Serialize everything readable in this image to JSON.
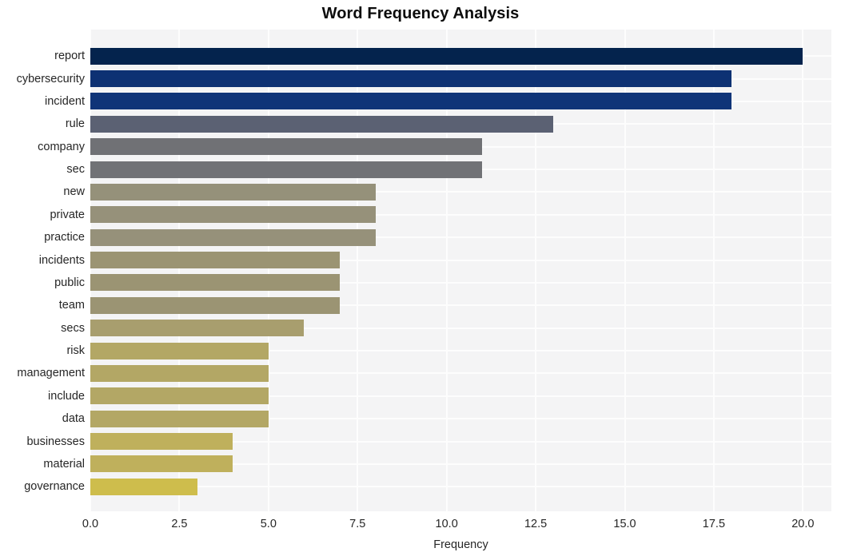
{
  "chart_data": {
    "type": "bar",
    "orientation": "horizontal",
    "title": "Word Frequency Analysis",
    "xlabel": "Frequency",
    "ylabel": "",
    "xlim": [
      0,
      20.8
    ],
    "xticks": [
      "0.0",
      "2.5",
      "5.0",
      "7.5",
      "10.0",
      "12.5",
      "15.0",
      "17.5",
      "20.0"
    ],
    "xtick_values": [
      0,
      2.5,
      5,
      7.5,
      10,
      12.5,
      15,
      17.5,
      20
    ],
    "grid": true,
    "legend": false,
    "categories": [
      "report",
      "cybersecurity",
      "incident",
      "rule",
      "company",
      "sec",
      "new",
      "private",
      "practice",
      "incidents",
      "public",
      "team",
      "secs",
      "risk",
      "management",
      "include",
      "data",
      "businesses",
      "material",
      "governance"
    ],
    "values": [
      20,
      18,
      18,
      13,
      11,
      11,
      8,
      8,
      8,
      7,
      7,
      7,
      6,
      5,
      5,
      5,
      5,
      4,
      4,
      3
    ],
    "bar_colors": [
      "#04234d",
      "#0d3173",
      "#0f3478",
      "#5b6173",
      "#707175",
      "#717276",
      "#95917a",
      "#96917a",
      "#96917a",
      "#9b9473",
      "#9b9473",
      "#9b9473",
      "#a89e6e",
      "#b3a765",
      "#b3a765",
      "#b3a765",
      "#b3a765",
      "#bfb05c",
      "#bfb05c",
      "#cebd4c"
    ]
  },
  "style": {
    "plot_background": "#f4f4f5",
    "grid_color": "#fdfdfd",
    "figure_background": "#ffffff",
    "text_color": "#262626",
    "title_color": "#0d0d0d"
  }
}
